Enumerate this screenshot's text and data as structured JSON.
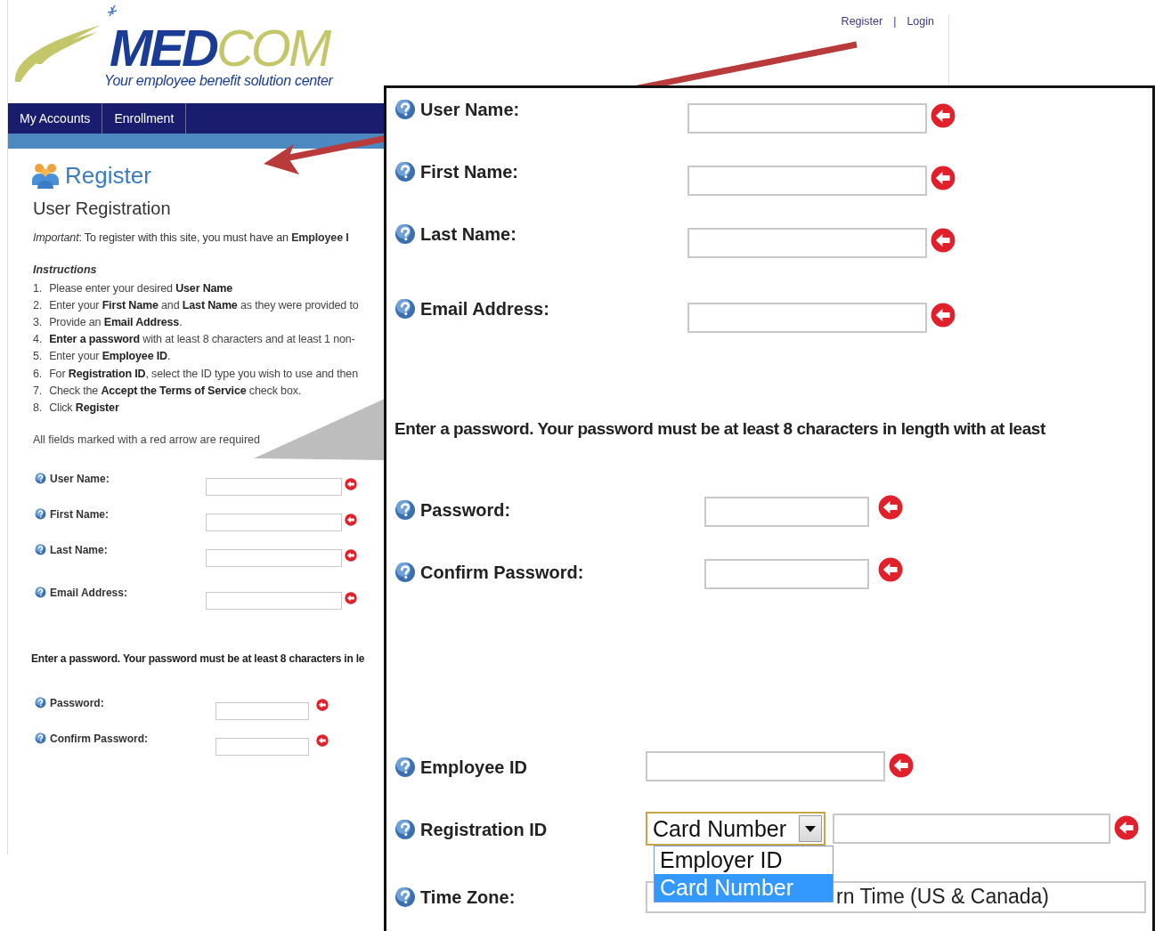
{
  "header": {
    "logo": {
      "brand": "**MED**COM",
      "tagline": "Your employee benefit solution center"
    },
    "top_links": [
      {
        "label": "Register"
      },
      {
        "label": "Login"
      }
    ],
    "separator": "|"
  },
  "nav": {
    "items": [
      {
        "label": "My Accounts"
      },
      {
        "label": "Enrollment"
      }
    ]
  },
  "page": {
    "title": "Register",
    "subtitle": "User Registration",
    "important": "*Important*: To register with this site, you must have an **Employee I**",
    "instructions_heading": "Instructions",
    "instructions": [
      {
        "number": "1.",
        "text": "Please enter your desired **User Name**"
      },
      {
        "number": "2.",
        "text": "Enter your **First Name** and **Last Name** as they were provided to"
      },
      {
        "number": "3.",
        "text": "Provide an **Email Address**."
      },
      {
        "number": "4.",
        "text": "**Enter a password** with at least 8 characters and at least 1 non-"
      },
      {
        "number": "5.",
        "text": "Enter your **Employee ID**."
      },
      {
        "number": "6.",
        "text": "For **Registration ID**, select the ID type you wish to use and then"
      },
      {
        "number": "7.",
        "text": "Check the **Accept the Terms of Service** check box."
      },
      {
        "number": "8.",
        "text": "Click **Register**"
      }
    ],
    "required_note": "All fields marked with a red arrow are required",
    "fields": [
      {
        "label": "User Name:",
        "required": true
      },
      {
        "label": "First Name:",
        "required": true
      },
      {
        "label": "Last Name:",
        "required": true
      },
      {
        "label": "Email Address:",
        "required": true
      }
    ],
    "password_note": "Enter a password. Your password must be at least 8 characters in le",
    "password_fields": [
      {
        "label": "Password:",
        "required": true
      },
      {
        "label": "Confirm Password:",
        "required": true
      }
    ]
  },
  "zoom": {
    "fields": [
      {
        "label": "User Name:",
        "required": true
      },
      {
        "label": "First Name:",
        "required": true
      },
      {
        "label": "Last Name:",
        "required": true
      },
      {
        "label": "Email Address:",
        "required": true
      }
    ],
    "password_note": "Enter a password. Your password must be at least 8 characters in length with at least",
    "password_fields": [
      {
        "label": "Password:",
        "required": true
      },
      {
        "label": "Confirm Password:",
        "required": true
      }
    ],
    "id_fields": [
      {
        "label": "Employee ID",
        "kind": "text",
        "required": true
      },
      {
        "label": "Registration ID",
        "kind": "select",
        "value": "Card Number",
        "required": true,
        "options": [
          {
            "label": "Employer ID",
            "selected": false
          },
          {
            "label": "Card Number",
            "selected": true
          }
        ]
      },
      {
        "label": "Time Zone:",
        "kind": "partial",
        "value": "rn Time (US & Canada)"
      }
    ]
  }
}
